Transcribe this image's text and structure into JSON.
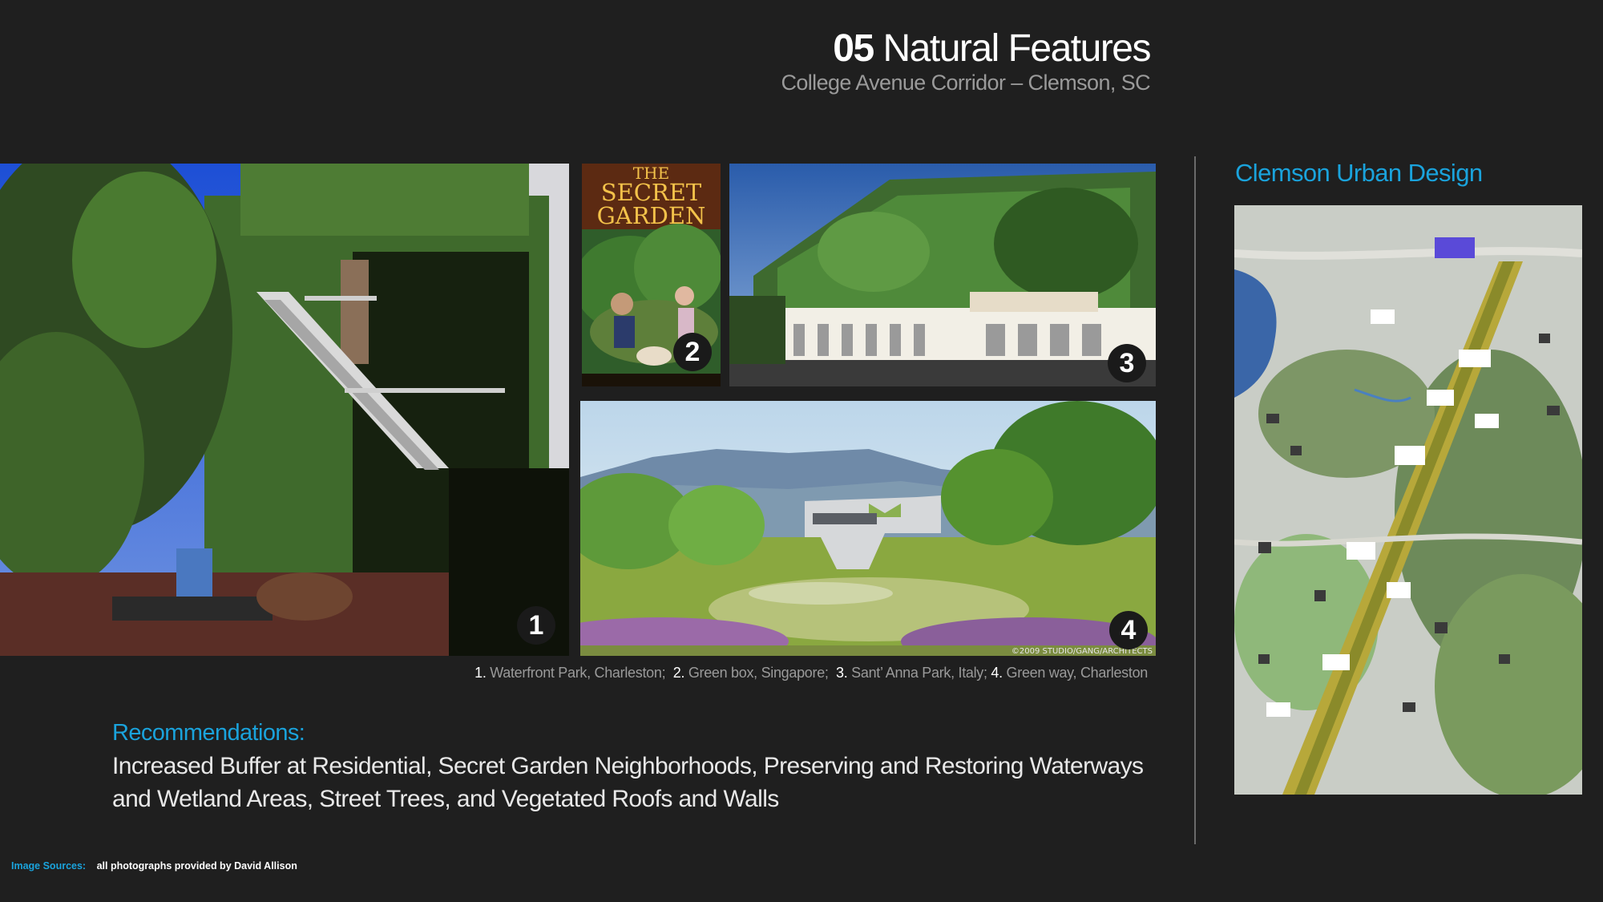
{
  "header": {
    "number": "05",
    "title": "Natural Features",
    "subtitle": "College Avenue Corridor – Clemson, SC"
  },
  "photos": [
    {
      "badge": "1",
      "icon": "ivy-wall-stair-photo"
    },
    {
      "badge": "2",
      "icon": "book-cover-photo",
      "cover_title_line1": "THE",
      "cover_title_line2": "SECRET",
      "cover_title_line3": "GARDEN"
    },
    {
      "badge": "3",
      "icon": "green-parking-garage-photo"
    },
    {
      "badge": "4",
      "icon": "park-pavilion-rendering",
      "credit": "©2009 STUDIO/GANG/ARCHITECTS"
    }
  ],
  "captions": [
    {
      "num": "1.",
      "text": "Waterfront Park, Charleston;"
    },
    {
      "num": "2.",
      "text": "Green box, Singapore;"
    },
    {
      "num": "3.",
      "text": "Sant’ Anna Park, Italy;"
    },
    {
      "num": "4.",
      "text": "Green way, Charleston"
    }
  ],
  "recommendations": {
    "heading": "Recommendations:",
    "body": "Increased Buffer at Residential, Secret Garden Neighborhoods, Preserving and Restoring Waterways and Wetland Areas, Street Trees, and Vegetated Roofs and Walls"
  },
  "map": {
    "title": "Clemson Urban Design",
    "icon": "site-plan-map"
  },
  "footer": {
    "label": "Image Sources:",
    "value": "all photographs provided by David Allison"
  },
  "colors": {
    "background": "#1f1f1f",
    "accent": "#1aa3dc",
    "muted_text": "#9a9a9a"
  }
}
